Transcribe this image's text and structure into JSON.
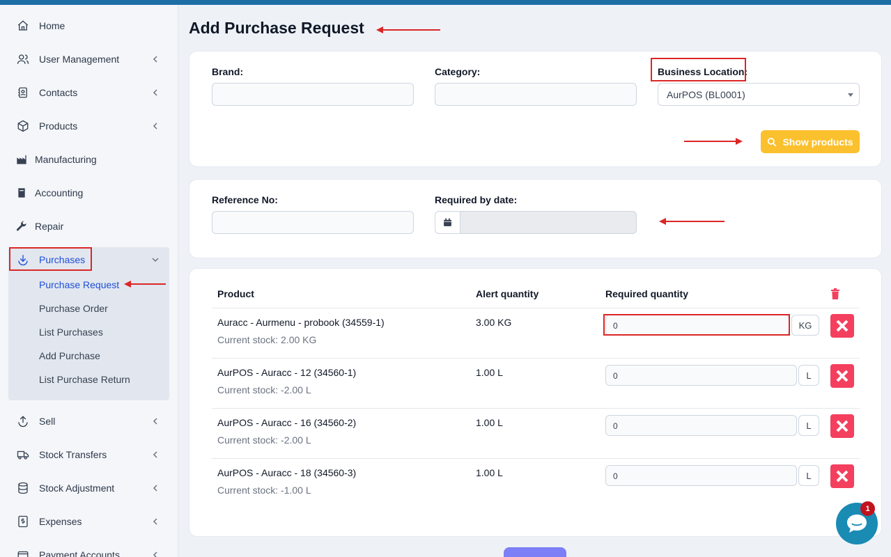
{
  "sidebar": {
    "items": [
      {
        "label": "Home",
        "icon": "home-icon"
      },
      {
        "label": "User Management",
        "icon": "users-icon"
      },
      {
        "label": "Contacts",
        "icon": "contacts-icon"
      },
      {
        "label": "Products",
        "icon": "box-icon"
      },
      {
        "label": "Manufacturing",
        "icon": "factory-icon"
      },
      {
        "label": "Accounting",
        "icon": "book-icon"
      },
      {
        "label": "Repair",
        "icon": "wrench-icon"
      },
      {
        "label": "Purchases",
        "icon": "download-arrow-icon"
      },
      {
        "label": "Sell",
        "icon": "upload-arrow-icon"
      },
      {
        "label": "Stock Transfers",
        "icon": "truck-icon"
      },
      {
        "label": "Stock Adjustment",
        "icon": "database-icon"
      },
      {
        "label": "Expenses",
        "icon": "dollar-file-icon"
      },
      {
        "label": "Payment Accounts",
        "icon": "wallet-icon"
      }
    ],
    "purchases_sub": [
      "Purchase Request",
      "Purchase Order",
      "List Purchases",
      "Add Purchase",
      "List Purchase Return"
    ]
  },
  "page": {
    "title": "Add Purchase Request"
  },
  "filters": {
    "brand_label": "Brand:",
    "category_label": "Category:",
    "location_label": "Business Location:",
    "location_value": "AurPOS (BL0001)",
    "show_products_label": "Show products"
  },
  "ref": {
    "reference_label": "Reference No:",
    "required_date_label": "Required by date:"
  },
  "table": {
    "headers": {
      "product": "Product",
      "alert": "Alert quantity",
      "required": "Required quantity"
    },
    "rows": [
      {
        "product": "Auracc - Aurmenu - probook (34559-1)",
        "stock": "Current stock: 2.00 KG",
        "alert": "3.00 KG",
        "qty": "0",
        "unit": "KG"
      },
      {
        "product": "AurPOS - Auracc - 12 (34560-1)",
        "stock": "Current stock: -2.00 L",
        "alert": "1.00 L",
        "qty": "0",
        "unit": "L"
      },
      {
        "product": "AurPOS - Auracc - 16 (34560-2)",
        "stock": "Current stock: -2.00 L",
        "alert": "1.00 L",
        "qty": "0",
        "unit": "L"
      },
      {
        "product": "AurPOS - Auracc - 18 (34560-3)",
        "stock": "Current stock: -1.00 L",
        "alert": "1.00 L",
        "qty": "0",
        "unit": "L"
      }
    ]
  },
  "chat": {
    "badge": "1"
  },
  "colors": {
    "accent": "#1d4ed8",
    "button_yellow": "#fbc02d",
    "danger": "#f43f5e",
    "annotation_red": "#dc2626"
  }
}
